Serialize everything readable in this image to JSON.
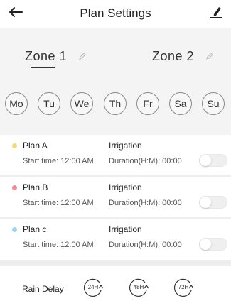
{
  "header": {
    "title": "Plan Settings",
    "back_icon": "back-arrow-icon",
    "edit_icon": "edit-pencil-icon"
  },
  "zones": [
    {
      "label": "Zone 1",
      "selected": true
    },
    {
      "label": "Zone 2",
      "selected": false
    }
  ],
  "days": [
    "Mo",
    "Tu",
    "We",
    "Th",
    "Fr",
    "Sa",
    "Su"
  ],
  "plans": [
    {
      "name": "Plan A",
      "start": "Start time: 12:00 AM",
      "type": "Irrigation",
      "duration": "Duration(H:M): 00:00",
      "color": "#f6d879",
      "enabled": false
    },
    {
      "name": "Plan B",
      "start": "Start time: 12:00 AM",
      "type": "Irrigation",
      "duration": "Duration(H:M): 00:00",
      "color": "#ef8d97",
      "enabled": false
    },
    {
      "name": "Plan c",
      "start": "Start time: 12:00 AM",
      "type": "Irrigation",
      "duration": "Duration(H:M): 00:00",
      "color": "#9ed3f2",
      "enabled": false
    }
  ],
  "rain_delay": {
    "label": "Rain Delay",
    "options": [
      "24H",
      "48H",
      "72H"
    ]
  },
  "colors": {
    "panel_bg": "#f4f4f5",
    "accent_dark": "#222222"
  }
}
